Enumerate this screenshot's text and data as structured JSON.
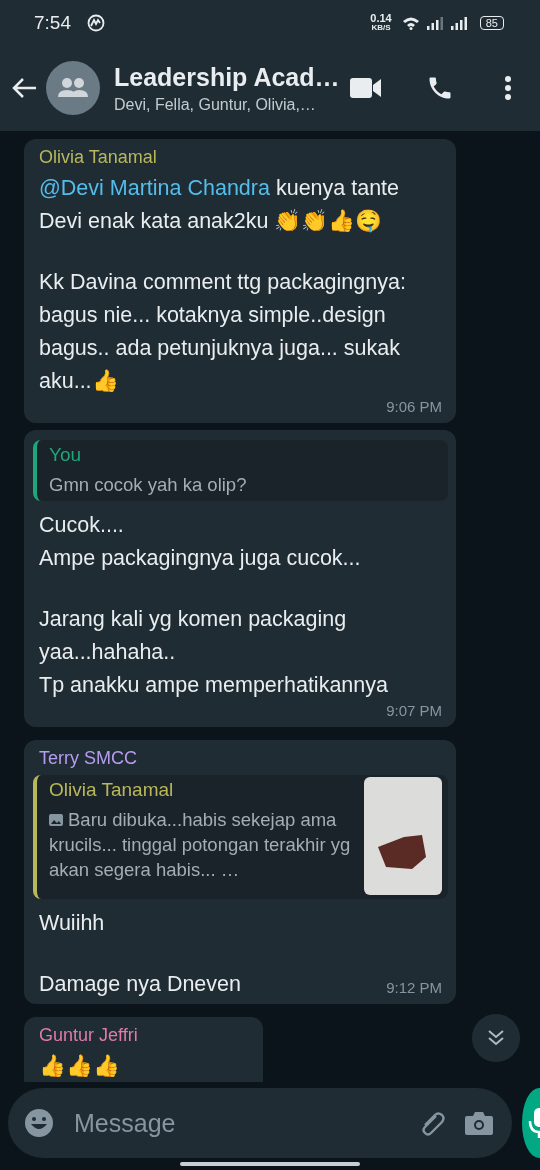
{
  "status_bar": {
    "time": "7:54",
    "speed": "0.14",
    "speed_unit": "KB/S",
    "battery": "85"
  },
  "header": {
    "title": "Leadership Acad…",
    "subtitle": "Devi, Fella, Guntur, Olivia,…"
  },
  "messages": [
    {
      "sender": "Olivia Tanamal",
      "color": "#b8b85a",
      "paragraphs": [
        {
          "mention": "@Devi Martina Chandra",
          "text": " kuenya tante Devi enak kata anak2ku 👏👏👍🤤"
        },
        {
          "text": "Kk Davina comment ttg packagingnya: bagus nie... kotaknya simple..design bagus.. ada petunjuknya juga... sukak aku...👍"
        }
      ],
      "time": "9:06 PM"
    },
    {
      "quote": {
        "author": "You",
        "color": "#1fa67a",
        "image": false,
        "text": "Gmn cocok yah ka olip?"
      },
      "paragraphs": [
        {
          "text": "Cucok....\nAmpe packagingnya juga cucok..."
        },
        {
          "text": "Jarang kali yg komen packaging yaa...hahaha..\nTp anakku ampe memperhatikannya"
        }
      ],
      "time": "9:07 PM"
    },
    {
      "sender": "Terry SMCC",
      "color": "#b69cf0",
      "quote": {
        "author": "Olivia Tanamal",
        "color": "#b8b85a",
        "image": true,
        "text": "Baru dibuka...habis sekejap ama krucils... tinggal potongan terakhir yg akan segera habis... …"
      },
      "paragraphs": [
        {
          "text": "Wuiihh"
        },
        {
          "text": "Damage nya Dneven"
        }
      ],
      "time": "9:12 PM"
    },
    {
      "sender": "Guntur Jeffri",
      "color": "#e07aa6",
      "paragraphs": [
        {
          "text": "👍👍👍"
        }
      ]
    }
  ],
  "composer": {
    "placeholder": "Message"
  }
}
